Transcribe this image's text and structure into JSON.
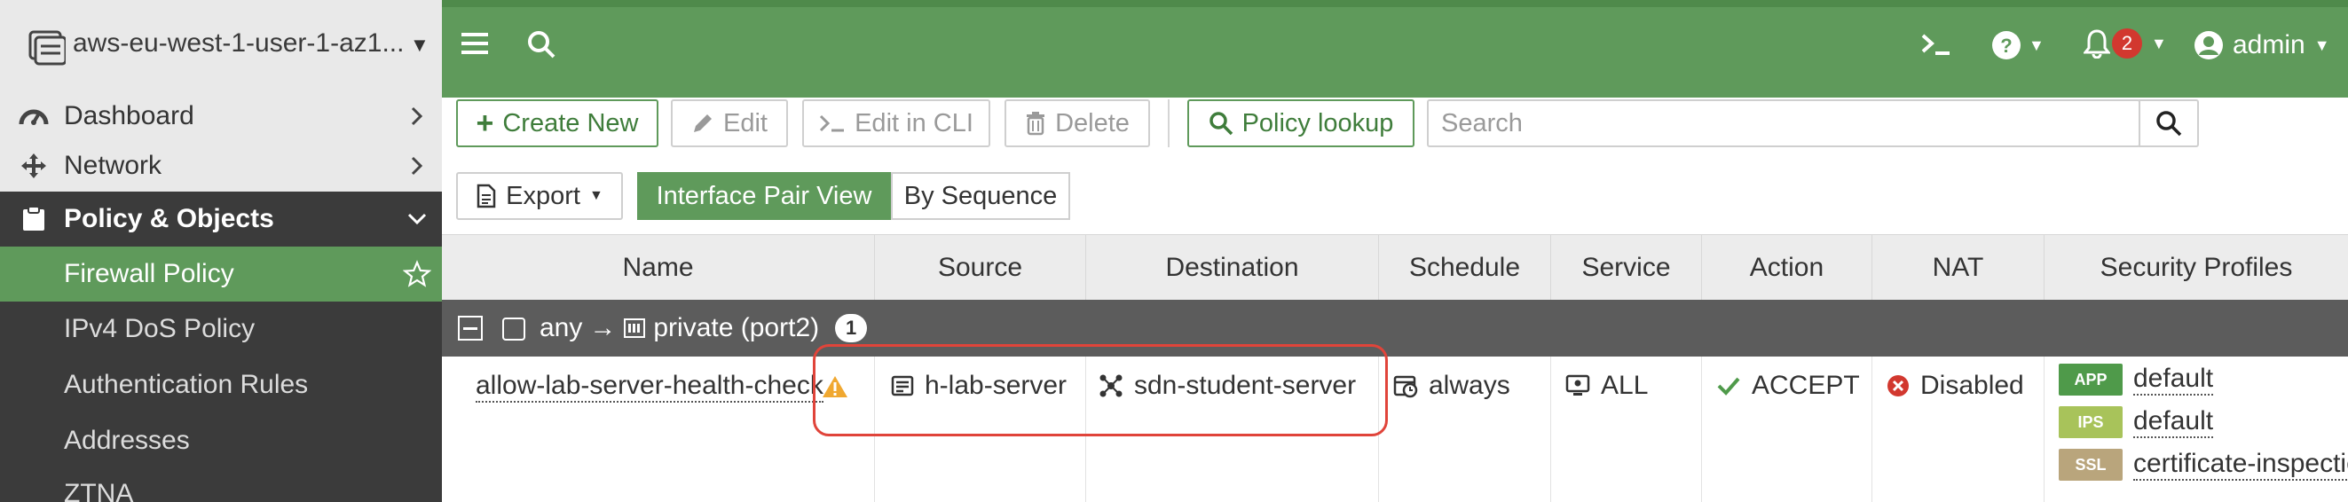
{
  "device": {
    "name": "aws-eu-west-1-user-1-az1..."
  },
  "sidebar": {
    "items": [
      {
        "label": "Dashboard",
        "icon": "dashboard-icon"
      },
      {
        "label": "Network",
        "icon": "network-icon"
      }
    ],
    "group": {
      "label": "Policy & Objects",
      "icon": "policy-objects-icon"
    },
    "subitems": [
      {
        "label": "Firewall Policy",
        "active": true
      },
      {
        "label": "IPv4 DoS Policy"
      },
      {
        "label": "Authentication Rules"
      },
      {
        "label": "Addresses"
      },
      {
        "label": "ZTNA"
      }
    ]
  },
  "topbar": {
    "notification_count": "2",
    "user": "admin"
  },
  "toolbar": {
    "create_new": "Create New",
    "edit": "Edit",
    "edit_cli": "Edit in CLI",
    "delete": "Delete",
    "policy_lookup": "Policy lookup",
    "search_placeholder": "Search",
    "export": "Export",
    "view_interface_pair": "Interface Pair View",
    "view_by_sequence": "By Sequence"
  },
  "table": {
    "columns": [
      "Name",
      "Source",
      "Destination",
      "Schedule",
      "Service",
      "Action",
      "NAT",
      "Security Profiles"
    ],
    "group": {
      "from": "any",
      "arrow": "→",
      "to": "private (port2)",
      "count": "1"
    },
    "rows": [
      {
        "name": "allow-lab-server-health-check",
        "source": "h-lab-server",
        "destination": "sdn-student-server",
        "schedule": "always",
        "service": "ALL",
        "action": "ACCEPT",
        "nat": "Disabled",
        "profiles": [
          {
            "tag": "APP",
            "value": "default",
            "color": "#4f9a4a"
          },
          {
            "tag": "IPS",
            "value": "default",
            "color": "#a8c35a"
          },
          {
            "tag": "SSL",
            "value": "certificate-inspection",
            "color": "#b9a57c"
          }
        ]
      }
    ]
  },
  "colors": {
    "brand_green": "#5f9a5b",
    "highlight_red": "#e0443a",
    "sidebar_dark": "#3b3b3b"
  }
}
